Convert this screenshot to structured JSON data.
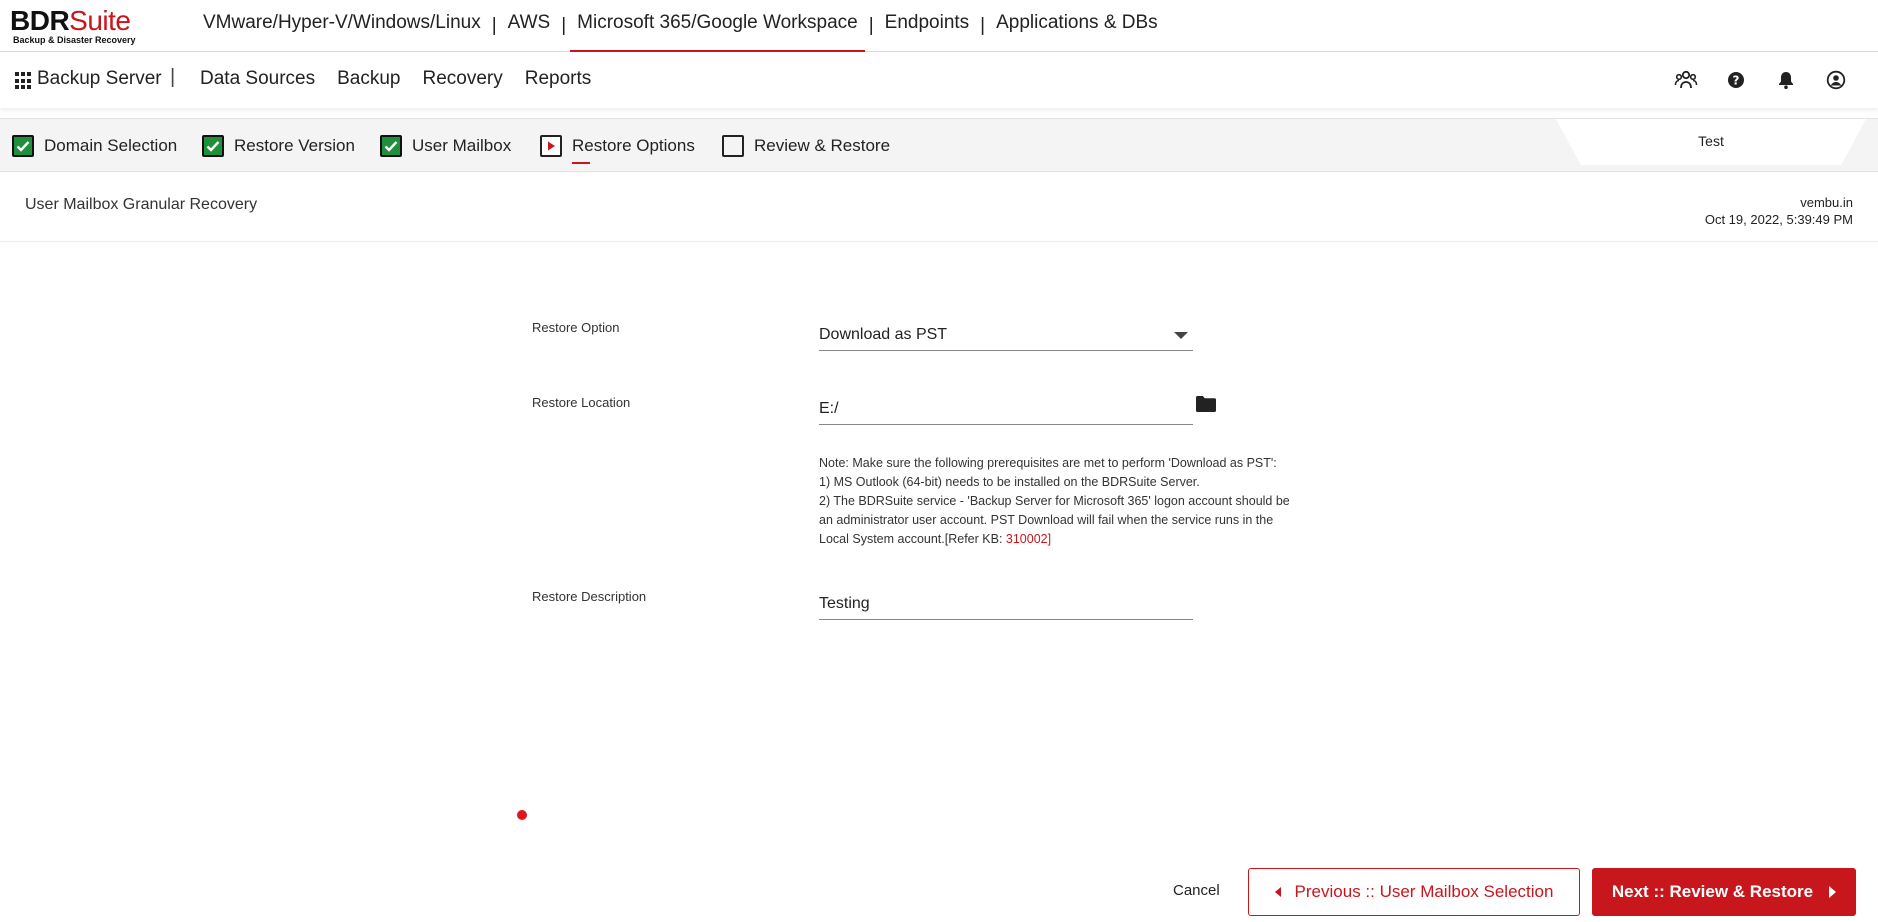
{
  "logo": {
    "brand_bold": "BDR",
    "brand_rest": "Suite",
    "tagline": "Backup & Disaster Recovery"
  },
  "products": [
    {
      "label": "VMware/Hyper-V/Windows/Linux",
      "active": false
    },
    {
      "label": "AWS",
      "active": false
    },
    {
      "label": "Microsoft 365/Google Workspace",
      "active": true
    },
    {
      "label": "Endpoints",
      "active": false
    },
    {
      "label": "Applications & DBs",
      "active": false
    }
  ],
  "product_separator": "|",
  "nav": {
    "app_name": "Backup Server",
    "separator": "|",
    "items": [
      "Data Sources",
      "Backup",
      "Recovery",
      "Reports"
    ],
    "icons": [
      "users-icon",
      "help-icon",
      "bell-icon",
      "account-icon"
    ]
  },
  "steps": [
    {
      "label": "Domain Selection",
      "state": "done"
    },
    {
      "label": "Restore Version",
      "state": "done"
    },
    {
      "label": "User Mailbox",
      "state": "done"
    },
    {
      "label": "Restore Options",
      "state": "current"
    },
    {
      "label": "Review & Restore",
      "state": "pending"
    }
  ],
  "tab_tag": "Test",
  "page": {
    "title": "User Mailbox Granular Recovery",
    "org": "vembu.in",
    "timestamp": "Oct 19, 2022, 5:39:49 PM"
  },
  "form": {
    "restore_option_label": "Restore Option",
    "restore_option_value": "Download as PST",
    "restore_location_label": "Restore Location",
    "restore_location_value": "E:/",
    "note_line1": "Note: Make sure the following prerequisites are met to perform 'Download as PST':",
    "note_line2": "1) MS Outlook (64-bit) needs to be installed on the BDRSuite Server.",
    "note_line3": "2) The BDRSuite service - 'Backup Server for Microsoft 365' logon account should be",
    "note_line4": "an administrator user account. PST Download will fail when the service runs in the",
    "note_line5_pre": "Local System account.[Refer KB: ",
    "note_kb": "310002",
    "note_line5_post": "]",
    "restore_description_label": "Restore Description",
    "restore_description_value": "Testing"
  },
  "footer": {
    "cancel": "Cancel",
    "previous": "Previous :: User Mailbox Selection",
    "next": "Next :: Review & Restore"
  },
  "colors": {
    "accent": "#c8161d",
    "done": "#1e8f3a"
  }
}
